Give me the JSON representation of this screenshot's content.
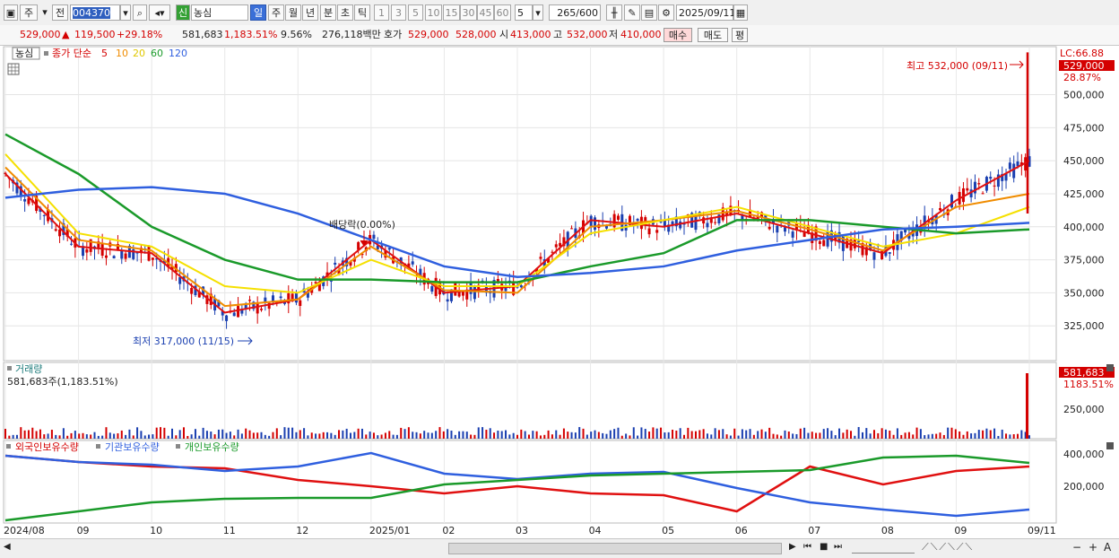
{
  "toolbar": {
    "mode_main": "주",
    "mode_prev": "전",
    "code": "004370",
    "name_badge": "신",
    "stock_name": "농심",
    "period_day": "일",
    "period_week": "주",
    "period_month": "월",
    "period_year": "년",
    "period_min": "분",
    "period_sec": "초",
    "period_tick": "틱",
    "nums": [
      "1",
      "3",
      "5",
      "10",
      "15",
      "30",
      "45",
      "60"
    ],
    "custom_num": "5",
    "count": "265",
    "count_total": "/600",
    "date": "2025/09/11"
  },
  "quote": {
    "price": "529,000",
    "change_arrow": "▲",
    "change": "119,500",
    "change_pct": "+29.18%",
    "volume": "581,683",
    "volume_pct": "1,183.51%",
    "turnover": "9.56%",
    "amount": "276,118백만",
    "ask_label": "호가",
    "ask1": "529,000",
    "ask2": "528,000",
    "open_label": "시",
    "open": "413,000",
    "high_label": "고",
    "high": "532,000",
    "low_label": "저",
    "low": "410,000",
    "buy": "매수",
    "sell": "매도",
    "eval": "평"
  },
  "price_panel": {
    "name": "농심",
    "legend_close": "종가 단순",
    "ma_labels": [
      "5",
      "10",
      "20",
      "60",
      "120"
    ],
    "lc_label": "LC:66.88",
    "cur_price_label": "529,000",
    "cur_pct_label": "28.87%",
    "high_note": "최고 532,000 (09/11)",
    "low_note": "최저 317,000 (11/15)",
    "dividend_note": "배당락(0.00%)",
    "y_ticks": [
      "500,000",
      "475,000",
      "450,000",
      "425,000",
      "400,000",
      "375,000",
      "350,000",
      "325,000"
    ]
  },
  "volume_panel": {
    "title": "거래량",
    "info": "581,683주(1,183.51%)",
    "cur_label": "581,683",
    "cur_pct": "1183.51%",
    "y_tick": "250,000"
  },
  "holding_panel": {
    "legend": [
      "외국인보유수량",
      "기관보유수량",
      "개인보유수량"
    ],
    "y_ticks": [
      "400,000",
      "200,000"
    ]
  },
  "x_axis": {
    "labels": [
      "2024/08",
      "09",
      "10",
      "11",
      "12",
      "2025/01",
      "02",
      "03",
      "04",
      "05",
      "06",
      "07",
      "08",
      "09",
      "09/11"
    ]
  },
  "colors": {
    "up": "#d40000",
    "down": "#1a3fb0",
    "ma5": "#e01010",
    "ma10": "#f08c00",
    "ma20": "#f5e000",
    "ma60": "#1a9a2a",
    "ma120": "#2f5fdf"
  },
  "chart_data": {
    "type": "line",
    "x": [
      "2024/08",
      "09",
      "10",
      "11",
      "12",
      "2025/01",
      "02",
      "03",
      "04",
      "05",
      "06",
      "07",
      "08",
      "09",
      "09/11"
    ],
    "series": [
      {
        "name": "5",
        "values": [
          440000,
          385000,
          380000,
          335000,
          345000,
          390000,
          350000,
          355000,
          405000,
          400000,
          410000,
          395000,
          380000,
          420000,
          450000
        ]
      },
      {
        "name": "10",
        "values": [
          445000,
          390000,
          382000,
          340000,
          345000,
          385000,
          352000,
          350000,
          400000,
          405000,
          412000,
          398000,
          382000,
          415000,
          425000
        ]
      },
      {
        "name": "20",
        "values": [
          455000,
          395000,
          385000,
          355000,
          350000,
          375000,
          355000,
          355000,
          395000,
          405000,
          415000,
          400000,
          385000,
          395000,
          415000
        ]
      },
      {
        "name": "60",
        "values": [
          470000,
          440000,
          400000,
          375000,
          360000,
          360000,
          358000,
          358000,
          370000,
          380000,
          405000,
          405000,
          400000,
          395000,
          398000
        ]
      },
      {
        "name": "120",
        "values": [
          422000,
          428000,
          430000,
          425000,
          410000,
          390000,
          370000,
          362000,
          365000,
          370000,
          382000,
          390000,
          398000,
          400000,
          403000
        ]
      }
    ],
    "ylim": [
      300000,
      535000
    ]
  }
}
